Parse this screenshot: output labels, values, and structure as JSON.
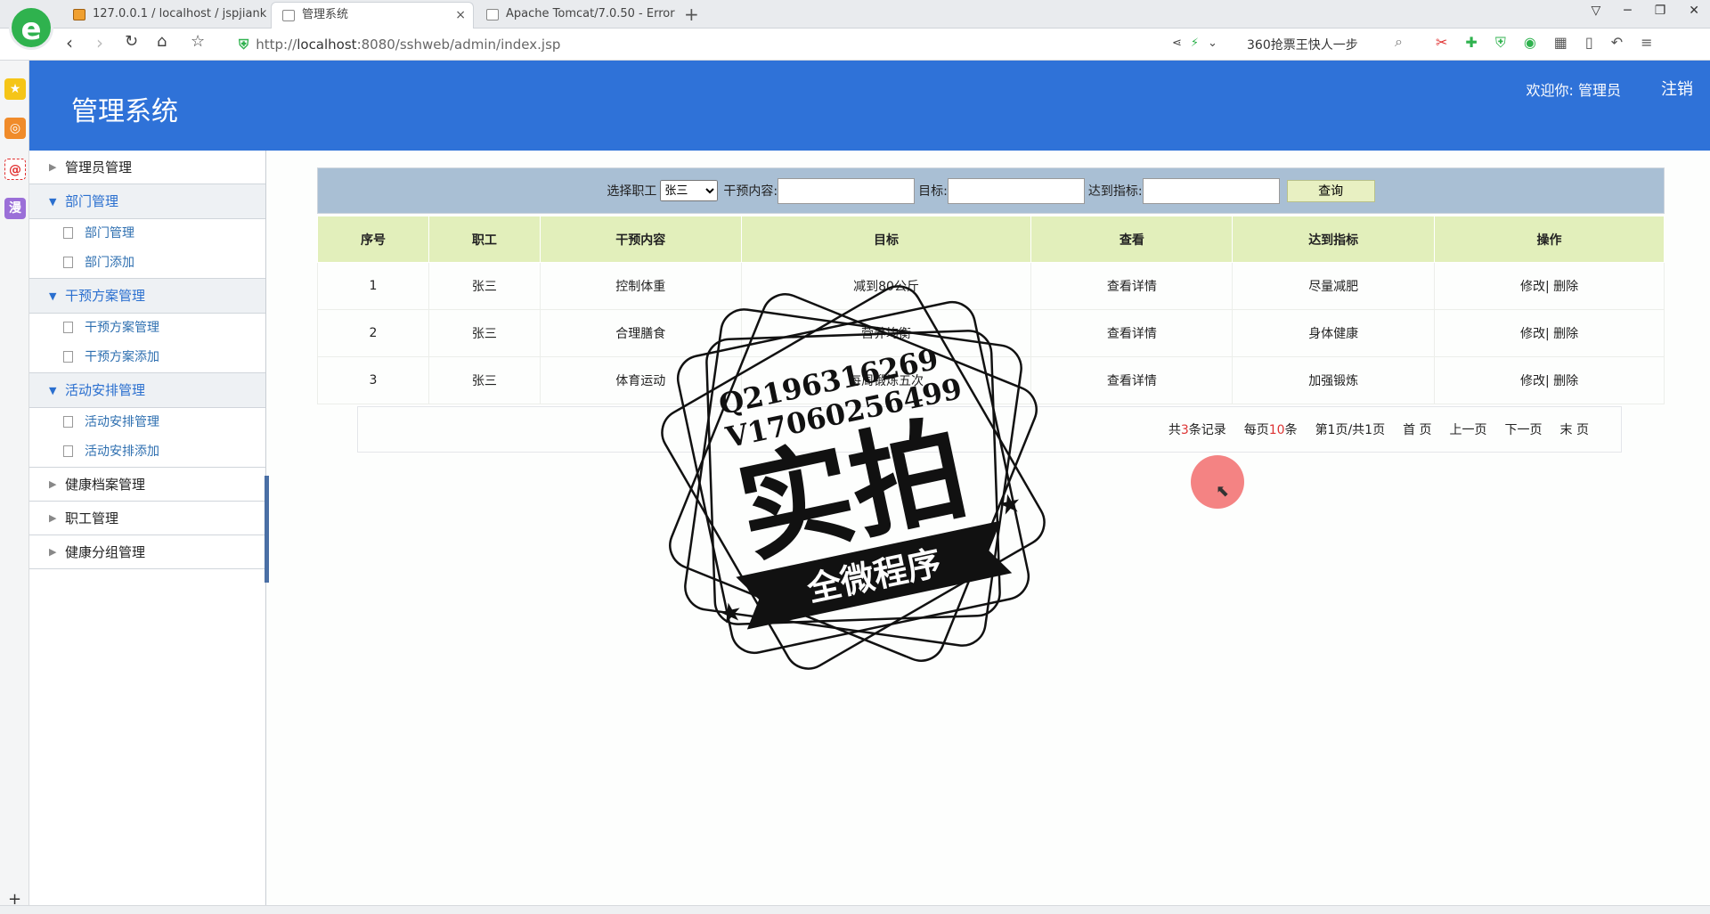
{
  "browser": {
    "logo": "e",
    "tabs": [
      {
        "title": "127.0.0.1 / localhost / jspjiank",
        "active": false
      },
      {
        "title": "管理系统",
        "active": true
      },
      {
        "title": "Apache Tomcat/7.0.50 - Error",
        "active": false
      }
    ],
    "close_glyph": "×",
    "new_tab_glyph": "+",
    "url_prefix": "http://",
    "url_host": "localhost",
    "url_rest": ":8080/sshweb/admin/index.jsp",
    "search_hint": "360抢票王快人一步"
  },
  "header": {
    "title": "管理系统",
    "welcome": "欢迎你: 管理员",
    "logout": "注销",
    "color": "#2f72d8"
  },
  "menu": {
    "admin": "管理员管理",
    "dept": "部门管理",
    "dept_sub": [
      "部门管理",
      "部门添加"
    ],
    "plan": "干预方案管理",
    "plan_sub": [
      "干预方案管理",
      "干预方案添加"
    ],
    "activity": "活动安排管理",
    "activity_sub": [
      "活动安排管理",
      "活动安排添加"
    ],
    "health": "健康档案管理",
    "staff": "职工管理",
    "group": "健康分组管理"
  },
  "query": {
    "employee_label": "选择职工",
    "employee_value": "张三",
    "content_label": "干预内容:",
    "target_label": "目标:",
    "indicator_label": "达到指标:",
    "search_button": "查询"
  },
  "table": {
    "headers": [
      "序号",
      "职工",
      "干预内容",
      "目标",
      "查看",
      "达到指标",
      "操作"
    ],
    "rows": [
      {
        "no": "1",
        "staff": "张三",
        "content": "控制体重",
        "target": "减到80公斤",
        "view": "查看详情",
        "indicator": "尽量减肥",
        "edit": "修改|",
        "delete": "删除"
      },
      {
        "no": "2",
        "staff": "张三",
        "content": "合理膳食",
        "target": "营养均衡",
        "view": "查看详情",
        "indicator": "身体健康",
        "edit": "修改|",
        "delete": "删除"
      },
      {
        "no": "3",
        "staff": "张三",
        "content": "体育运动",
        "target": "每周锻炼五次",
        "view": "查看详情",
        "indicator": "加强锻炼",
        "edit": "修改|",
        "delete": "删除"
      }
    ]
  },
  "pager": {
    "total_prefix": "共",
    "total_count": "3",
    "total_suffix": "条记录",
    "per_page_prefix": "每页",
    "per_page_count": "10",
    "per_page_suffix": "条",
    "page_info": "第1页/共1页",
    "first": "首 页",
    "prev": "上一页",
    "next": "下一页",
    "last": "末 页"
  },
  "stamp": {
    "qq": "Q2196316269",
    "vx": "V17060256499",
    "main": "实拍",
    "banner": "全微程序"
  }
}
